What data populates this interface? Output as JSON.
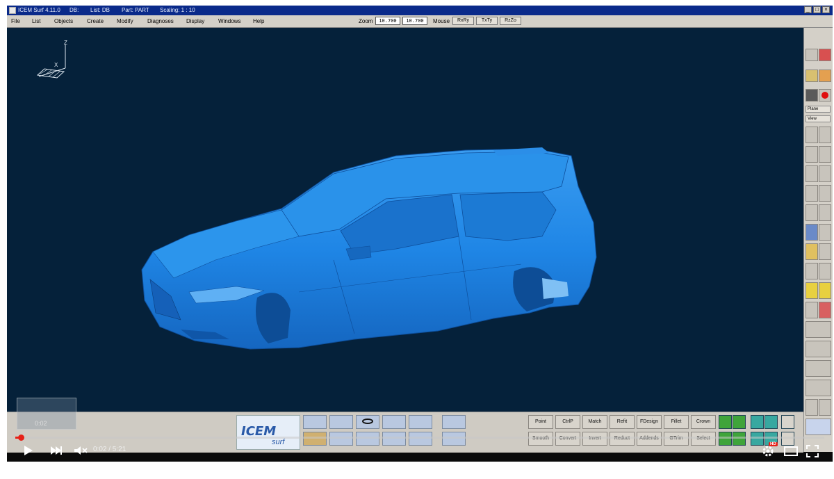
{
  "title_bar": {
    "app": "ICEM Surf 4.11.0",
    "db": "DB:",
    "list": "List: DB",
    "part": "Part: PART",
    "scaling": "Scaling: 1 : 10"
  },
  "menu": {
    "items": [
      "File",
      "List",
      "Objects",
      "Create",
      "Modify",
      "Diagnoses",
      "Display",
      "Windows",
      "Help"
    ],
    "zoom_label": "Zoom",
    "zoom_values": [
      "10.700",
      "10.700"
    ],
    "mouse_label": "Mouse",
    "mouse_buttons": [
      "RxRy",
      "TxTy",
      "RzZo"
    ]
  },
  "axis_labels": {
    "z": "Z",
    "x": "X"
  },
  "right_toolbar": {
    "dropdown_1": "Plane",
    "dropdown_2": "View"
  },
  "logo_text": {
    "brand": "ICEM",
    "sub": "surf"
  },
  "function_buttons": {
    "row1": [
      "Point",
      "CtrlP",
      "Match",
      "Refit",
      "FDesign",
      "Fillet",
      "Crown"
    ],
    "row2": [
      "Smooth",
      "Convert",
      "Invert",
      "Reduct",
      "Addends",
      "GTrim",
      "Select"
    ]
  },
  "player": {
    "time_current": "0:02",
    "time_total": "5:21",
    "time_display": "0:02 / 5:21",
    "thumb_time": "0:02",
    "hd_badge": "HD",
    "progress": 0.006
  },
  "colors": {
    "viewport_bg": "#05213a",
    "car_body": "#1f86e6",
    "title_bar": "#0a2a8a",
    "progress": "#e62117"
  }
}
